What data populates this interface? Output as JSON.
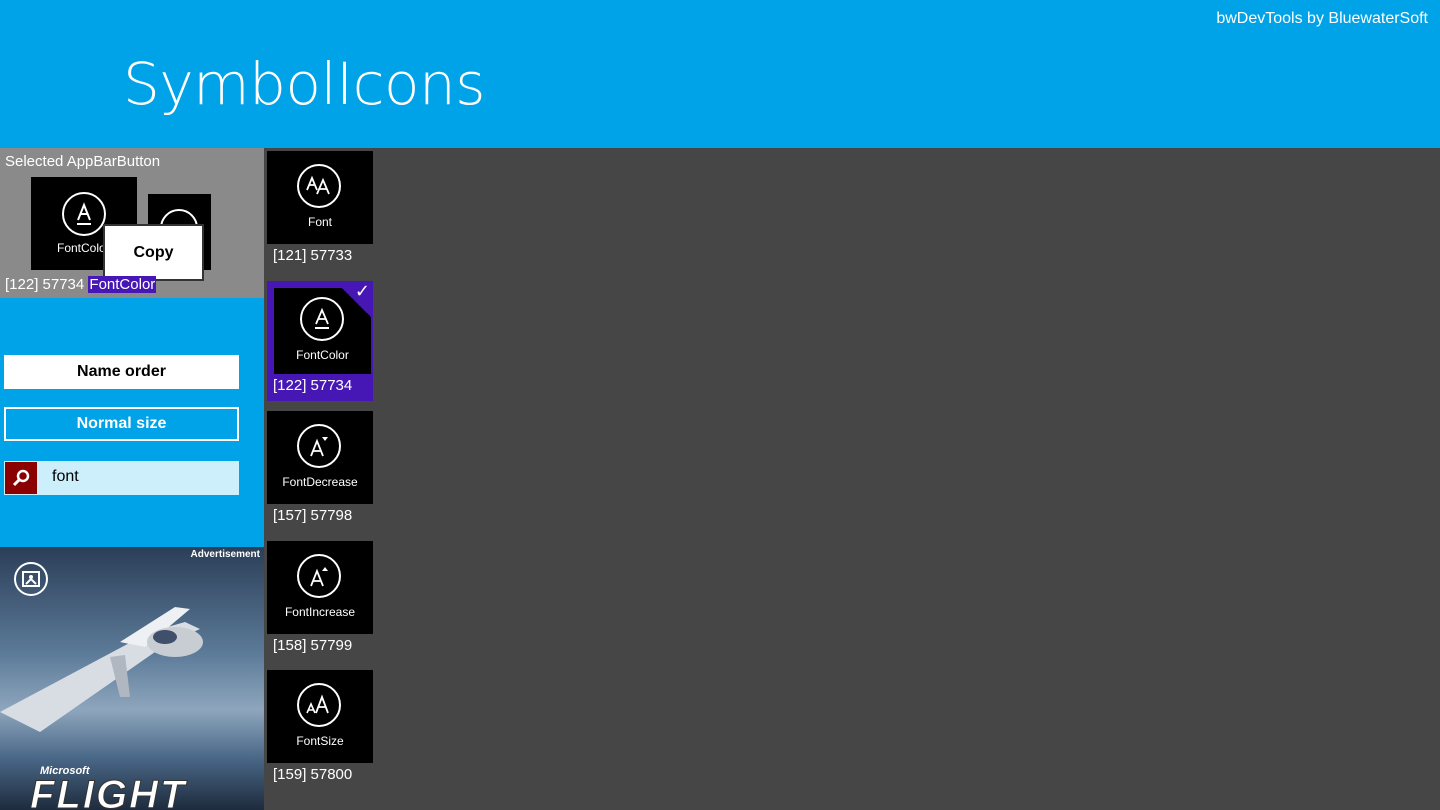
{
  "header": {
    "title": "SymbolIcons",
    "brand": "bwDevTools by BluewaterSoft"
  },
  "selected": {
    "heading": "Selected AppBarButton",
    "tile_label": "FontColor",
    "context_menu_item": "Copy",
    "code": "[122] 57734",
    "name": "FontColor"
  },
  "controls": {
    "order_button": "Name order",
    "size_button": "Normal size",
    "search_value": "font"
  },
  "ad": {
    "label": "Advertisement",
    "brand": "Microsoft",
    "title": "FLIGHT"
  },
  "icons": [
    {
      "name": "Font",
      "code": "[121] 57733",
      "glyph": "AA"
    },
    {
      "name": "FontColor",
      "code": "[122] 57734",
      "glyph": "A̲",
      "selected": true
    },
    {
      "name": "FontDecrease",
      "code": "[157] 57798",
      "glyph": "A▾"
    },
    {
      "name": "FontIncrease",
      "code": "[158] 57799",
      "glyph": "A▴"
    },
    {
      "name": "FontSize",
      "code": "[159] 57800",
      "glyph": "aA"
    }
  ],
  "colors": {
    "accent": "#00a2e8",
    "background": "#464646",
    "selection": "#4617b4",
    "search_button": "#8b0000"
  }
}
